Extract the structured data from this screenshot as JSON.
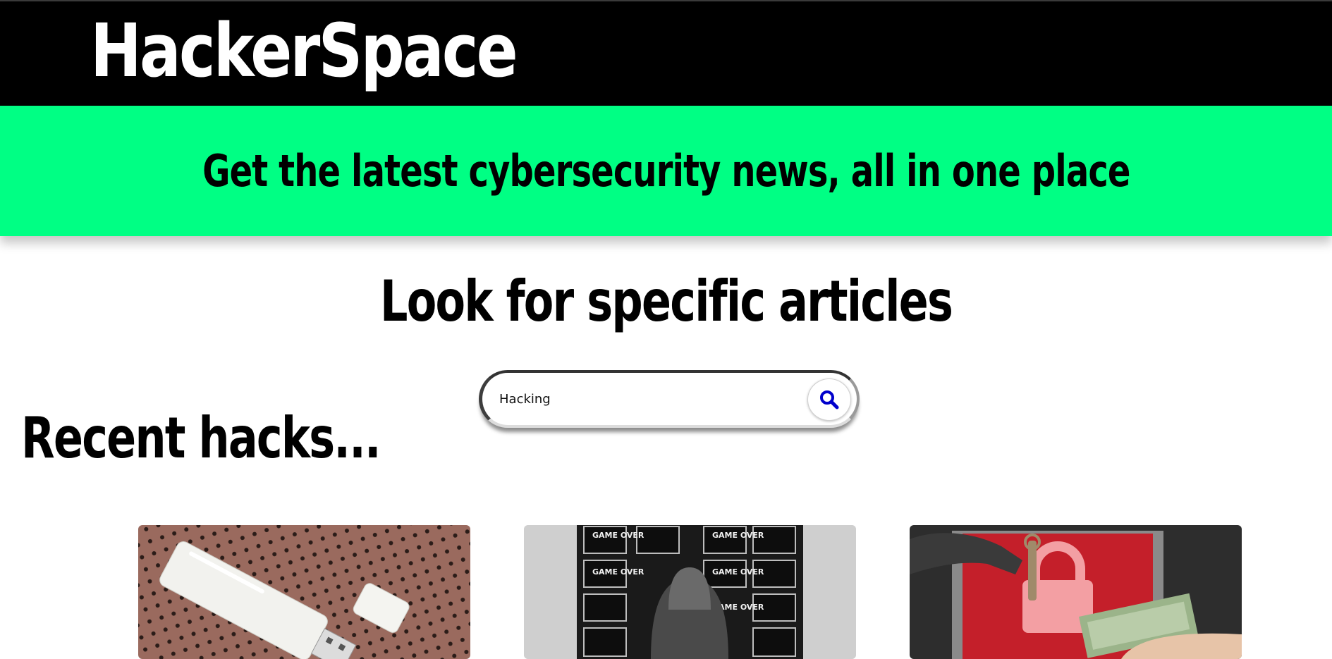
{
  "header": {
    "logo_text": "HackerSpace"
  },
  "banner": {
    "tagline": "Get the latest cybersecurity news, all in one place"
  },
  "search": {
    "heading": "Look for specific articles",
    "value": "Hacking",
    "button_icon": "search-icon"
  },
  "recent": {
    "heading": "Recent hacks..."
  },
  "cards": [
    {
      "image": "usb-drive-image"
    },
    {
      "image": "hooded-hacker-game-over-image",
      "screen_text": "GAME OVER"
    },
    {
      "image": "ransomware-lock-cash-image"
    }
  ],
  "colors": {
    "header_bg": "#000000",
    "banner_bg": "#00ff84",
    "search_icon": "#0000cc"
  }
}
